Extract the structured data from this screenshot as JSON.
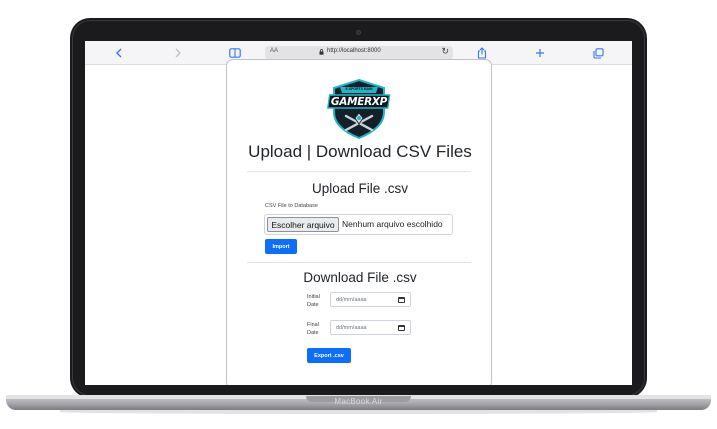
{
  "browser": {
    "url": "http://localhost:8000",
    "text_size_label": "AA"
  },
  "page": {
    "logo_text": "GAMERXP",
    "logo_ribbon_text": "E-SPORTS MAIN",
    "title": "Upload | Download CSV Files",
    "upload": {
      "heading": "Upload File .csv",
      "field_label": "CSV File to Database",
      "choose_button": "Escolher arquivo",
      "no_file_text": "Nenhum arquivo escolhido",
      "import_button": "Import"
    },
    "download": {
      "heading": "Download File .csv",
      "initial_label_line1": "Initial",
      "initial_label_line2": "Date",
      "final_label_line1": "Final",
      "final_label_line2": "Date",
      "date_placeholder": "dd/mm/aaaa",
      "export_button": "Export .csv"
    }
  },
  "device": {
    "label": "MacBook Air"
  },
  "colors": {
    "accent": "#0d6efd",
    "safari_blue": "#3478f6",
    "logo_teal": "#1fb6c9",
    "bezel": "#1b1b1d"
  }
}
